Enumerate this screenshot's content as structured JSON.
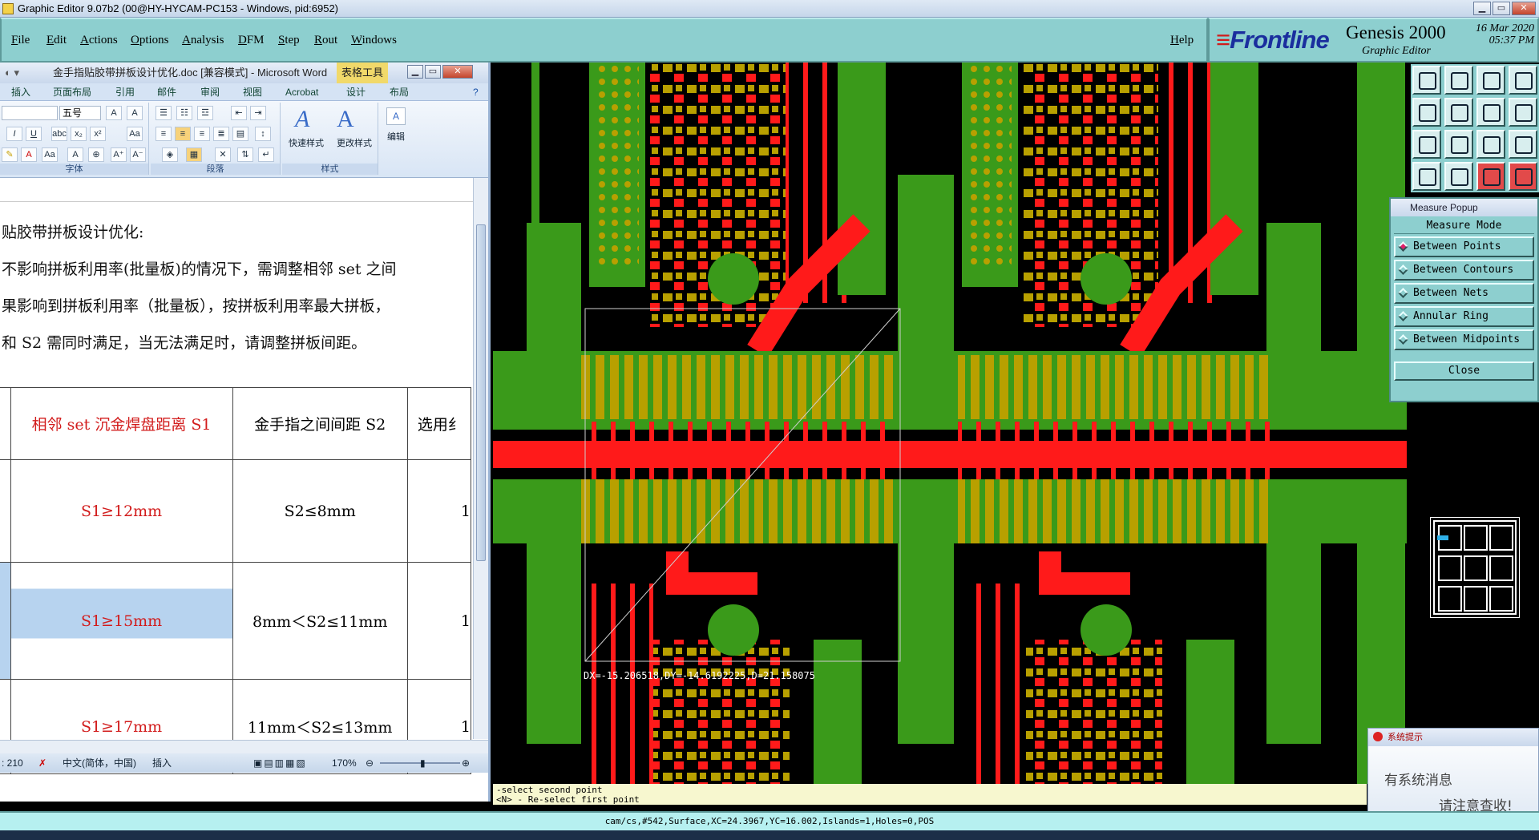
{
  "app": {
    "title": "Graphic Editor 9.07b2 (00@HY-HYCAM-PC153 - Windows, pid:6952)"
  },
  "menu": {
    "items": [
      "File",
      "Edit",
      "Actions",
      "Options",
      "Analysis",
      "DFM",
      "Step",
      "Rout",
      "Windows"
    ],
    "help": "Help"
  },
  "brand": {
    "logo_a": "Frontline",
    "product": "Genesis 2000",
    "subtitle": "Graphic Editor",
    "date": "16 Mar 2020",
    "time": "05:37 PM"
  },
  "word": {
    "title": "金手指贴胶带拼板设计优化.doc [兼容模式] - Microsoft Word",
    "context_tab": "表格工具",
    "tabs": [
      "插入",
      "页面布局",
      "引用",
      "邮件",
      "审阅",
      "视图",
      "Acrobat",
      "设计",
      "布局"
    ],
    "ribbon": {
      "font_size": "五号",
      "group_font": "字体",
      "group_paragraph": "段落",
      "group_styles": "样式",
      "quick_styles": "快速样式",
      "change_styles": "更改样式",
      "edit": "编辑"
    },
    "doc_lines": [
      "贴胶带拼板设计优化:",
      "不影响拼板利用率(批量板)的情况下，需调整相邻 set 之间",
      "果影响到拼板利用率（批量板），按拼板利用率最大拼板，",
      "和 S2 需同时满足，当无法满足时，请调整拼板间距。"
    ],
    "table": {
      "headers": [
        "相邻 set 沉金焊盘距离 S1",
        "金手指之间间距 S2",
        "选用纟"
      ],
      "rows": [
        [
          "S1≥12mm",
          "S2≤8mm",
          "1"
        ],
        [
          "S1≥15mm",
          "8mm＜S2≤11mm",
          "1"
        ],
        [
          "S1≥17mm",
          "11mm＜S2≤13mm",
          "1"
        ]
      ]
    },
    "status": {
      "words": ": 210",
      "language": "中文(简体，中国)",
      "mode": "插入",
      "zoom": "170%"
    }
  },
  "canvas": {
    "measure_readout": "DX=-15.206518,DY=-14.6192225,D=21.158075"
  },
  "measure_popup": {
    "title": "Measure Popup",
    "mode_label": "Measure Mode",
    "options": [
      "Between Points",
      "Between Contours",
      "Between Nets",
      "Annular Ring",
      "Between Midpoints"
    ],
    "selected": "Between Points",
    "close": "Close"
  },
  "prompt": {
    "line1": "-select second point",
    "line2": "<N> - Re-select first point"
  },
  "statusbar": "cam/cs,#542,Surface,XC=24.3967,YC=16.002,Islands=1,Holes=0,POS",
  "notify": {
    "title": "系统提示",
    "line1": "有系统消息",
    "line2": "请注意查收!"
  },
  "colors": {
    "copper_red": "#ff1a1a",
    "gold_pad": "#b8a000",
    "soldermask_green": "#3a9a1a",
    "panel_cyan": "#8dcfcf"
  }
}
